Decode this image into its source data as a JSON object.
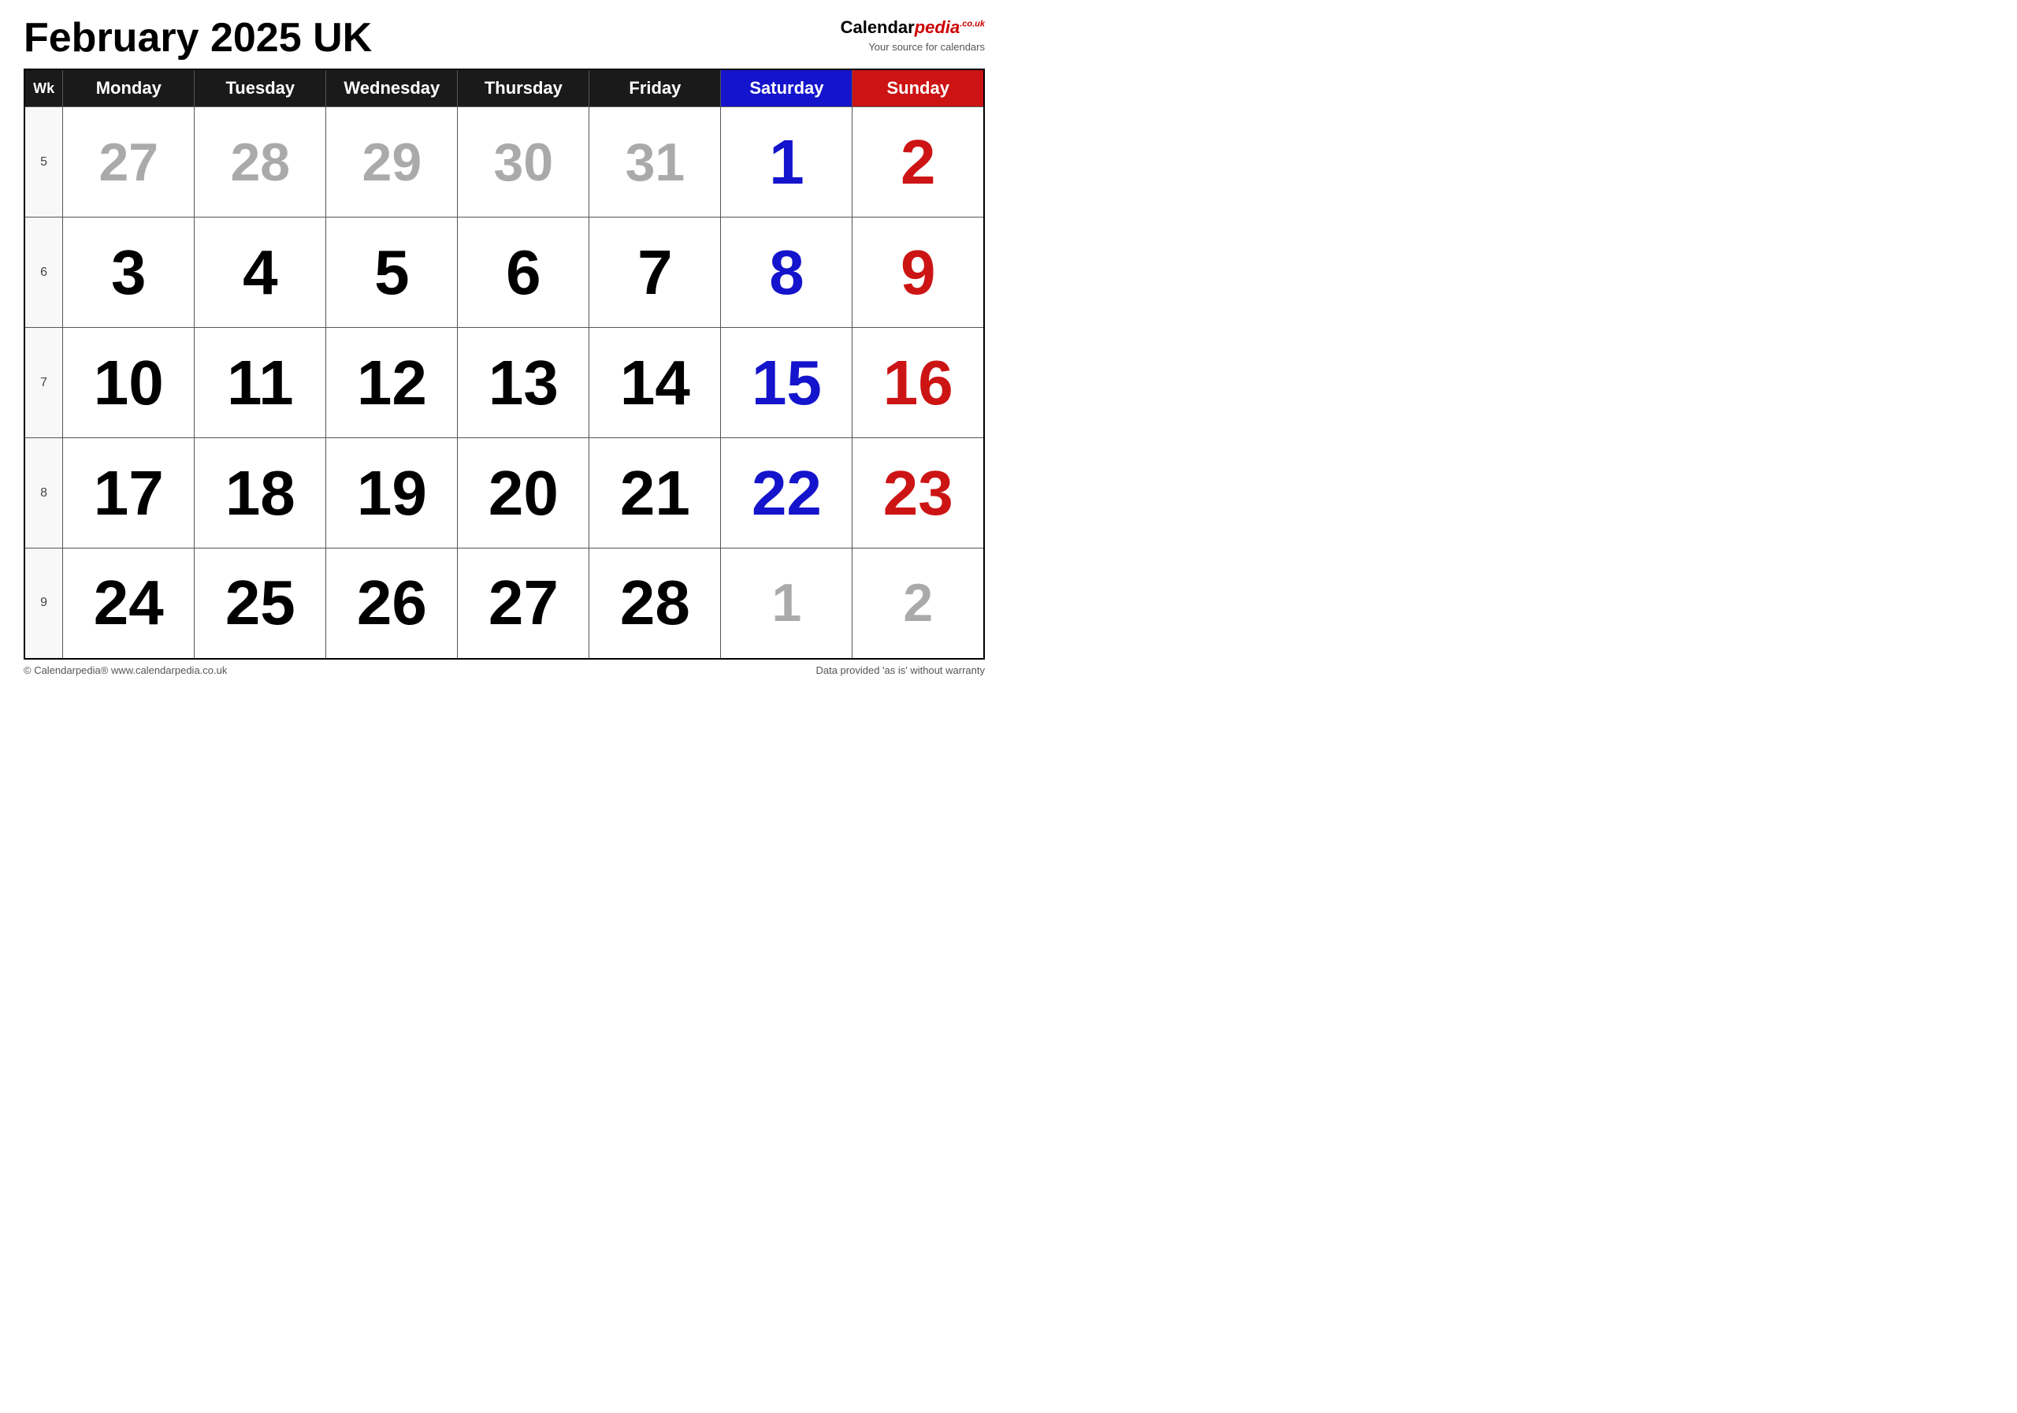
{
  "title": "February 2025 UK",
  "logo": {
    "brand": "Calendar",
    "brand_italic": "pedia",
    "tld": ".co.uk",
    "tagline": "Your source for calendars"
  },
  "headers": {
    "wk": "Wk",
    "monday": "Monday",
    "tuesday": "Tuesday",
    "wednesday": "Wednesday",
    "thursday": "Thursday",
    "friday": "Friday",
    "saturday": "Saturday",
    "sunday": "Sunday"
  },
  "weeks": [
    {
      "wk": "5",
      "days": [
        {
          "num": "27",
          "type": "prev-month"
        },
        {
          "num": "28",
          "type": "prev-month"
        },
        {
          "num": "29",
          "type": "prev-month"
        },
        {
          "num": "30",
          "type": "prev-month"
        },
        {
          "num": "31",
          "type": "prev-month"
        },
        {
          "num": "1",
          "type": "saturday"
        },
        {
          "num": "2",
          "type": "sunday"
        }
      ]
    },
    {
      "wk": "6",
      "days": [
        {
          "num": "3",
          "type": "normal"
        },
        {
          "num": "4",
          "type": "normal"
        },
        {
          "num": "5",
          "type": "normal"
        },
        {
          "num": "6",
          "type": "normal"
        },
        {
          "num": "7",
          "type": "normal"
        },
        {
          "num": "8",
          "type": "saturday"
        },
        {
          "num": "9",
          "type": "sunday"
        }
      ]
    },
    {
      "wk": "7",
      "days": [
        {
          "num": "10",
          "type": "normal"
        },
        {
          "num": "11",
          "type": "normal"
        },
        {
          "num": "12",
          "type": "normal"
        },
        {
          "num": "13",
          "type": "normal"
        },
        {
          "num": "14",
          "type": "normal"
        },
        {
          "num": "15",
          "type": "saturday"
        },
        {
          "num": "16",
          "type": "sunday"
        }
      ]
    },
    {
      "wk": "8",
      "days": [
        {
          "num": "17",
          "type": "normal"
        },
        {
          "num": "18",
          "type": "normal"
        },
        {
          "num": "19",
          "type": "normal"
        },
        {
          "num": "20",
          "type": "normal"
        },
        {
          "num": "21",
          "type": "normal"
        },
        {
          "num": "22",
          "type": "saturday"
        },
        {
          "num": "23",
          "type": "sunday"
        }
      ]
    },
    {
      "wk": "9",
      "days": [
        {
          "num": "24",
          "type": "normal"
        },
        {
          "num": "25",
          "type": "normal"
        },
        {
          "num": "26",
          "type": "normal"
        },
        {
          "num": "27",
          "type": "normal"
        },
        {
          "num": "28",
          "type": "normal"
        },
        {
          "num": "1",
          "type": "next-month"
        },
        {
          "num": "2",
          "type": "next-month"
        }
      ]
    }
  ],
  "footer": {
    "left": "© Calendarpedia®  www.calendarpedia.co.uk",
    "right": "Data provided 'as is' without warranty"
  }
}
